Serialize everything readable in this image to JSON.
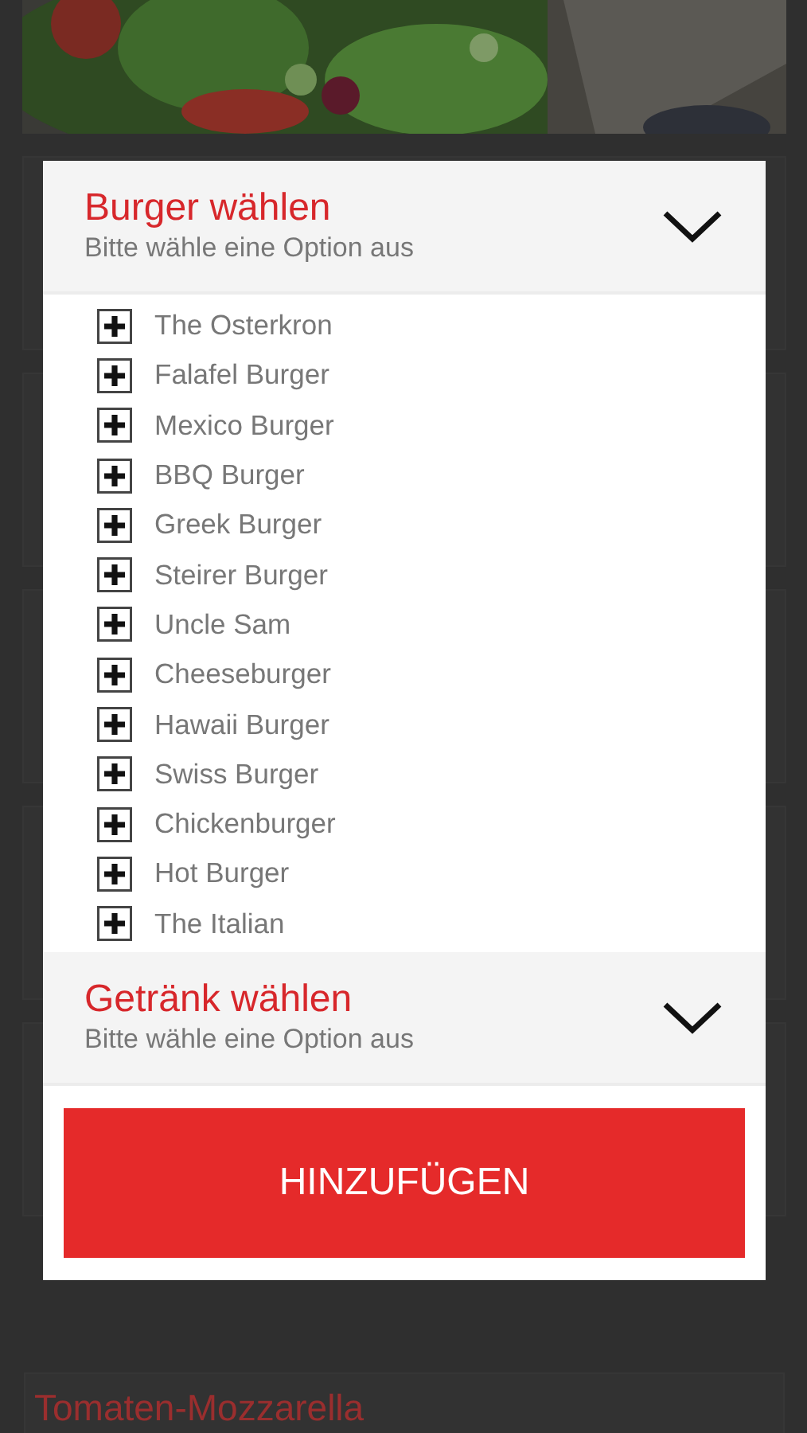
{
  "background": {
    "card_title": "Tomaten-Mozzarella"
  },
  "dialog": {
    "sections": [
      {
        "title": "Burger wählen",
        "subtitle": "Bitte wähle eine Option aus",
        "options": [
          "The Osterkron",
          "Falafel Burger",
          "Mexico Burger",
          "BBQ Burger",
          "Greek Burger",
          "Steirer Burger",
          "Uncle Sam",
          "Cheeseburger",
          "Hawaii Burger",
          "Swiss Burger",
          "Chickenburger",
          "Hot Burger",
          "The Italian"
        ]
      },
      {
        "title": "Getränk wählen",
        "subtitle": "Bitte wähle eine Option aus"
      }
    ],
    "button": "HINZUFÜGEN"
  }
}
